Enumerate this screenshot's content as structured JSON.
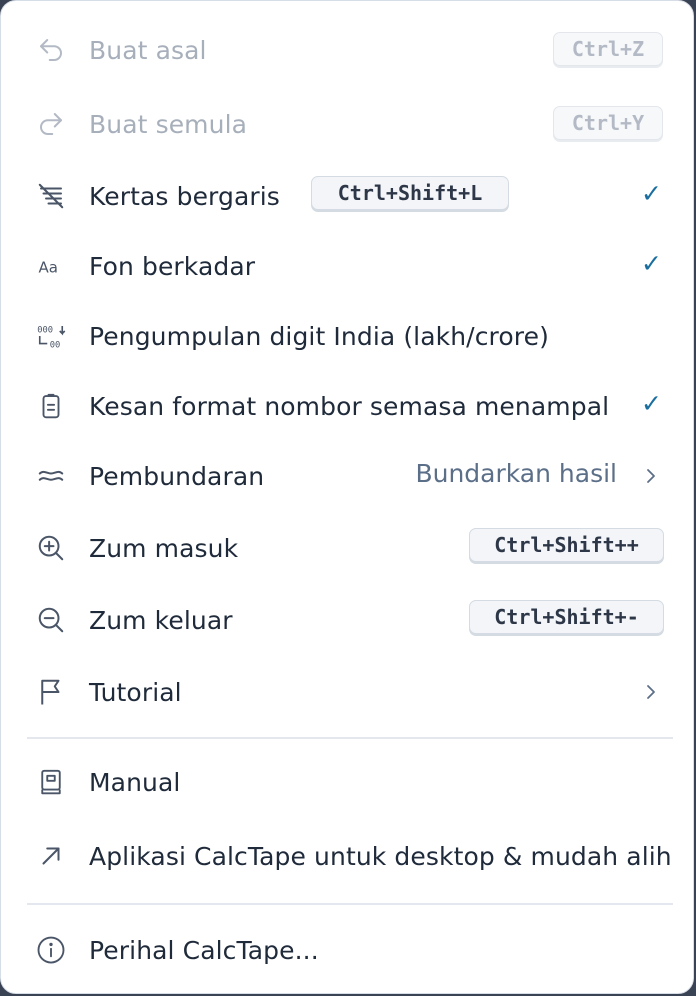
{
  "menu": {
    "undo": {
      "label": "Buat asal",
      "shortcut": "Ctrl+Z",
      "icon": "undo-icon"
    },
    "redo": {
      "label": "Buat semula",
      "shortcut": "Ctrl+Y",
      "icon": "redo-icon"
    },
    "lined_paper": {
      "label": "Kertas bergaris",
      "shortcut": "Ctrl+Shift+L",
      "checked": true,
      "icon": "lined-paper-icon"
    },
    "proportional_font": {
      "label": "Fon berkadar",
      "checked": true,
      "icon": "font-icon"
    },
    "indian_grouping": {
      "label": "Pengumpulan digit India (lakh/crore)",
      "checked": false,
      "icon": "digit-grouping-icon"
    },
    "paste_format": {
      "label": "Kesan format nombor semasa menampal",
      "checked": true,
      "icon": "clipboard-icon"
    },
    "rounding": {
      "label": "Pembundaran",
      "value": "Bundarkan hasil",
      "icon": "approx-icon"
    },
    "zoom_in": {
      "label": "Zum masuk",
      "shortcut": "Ctrl+Shift++",
      "icon": "zoom-in-icon"
    },
    "zoom_out": {
      "label": "Zum keluar",
      "shortcut": "Ctrl+Shift+-",
      "icon": "zoom-out-icon"
    },
    "tutorial": {
      "label": "Tutorial",
      "icon": "flag-icon"
    },
    "manual": {
      "label": "Manual",
      "icon": "book-icon"
    },
    "apps": {
      "label": "Aplikasi CalcTape untuk desktop & mudah alih",
      "icon": "external-arrow-icon"
    },
    "about": {
      "label": "Perihal CalcTape...",
      "icon": "info-icon"
    },
    "check_glyph": "✓"
  },
  "colors": {
    "accent": "#1a6ea0",
    "text": "#1f2a3a",
    "disabled": "#a7afbb",
    "secondary": "#5c6f88"
  }
}
